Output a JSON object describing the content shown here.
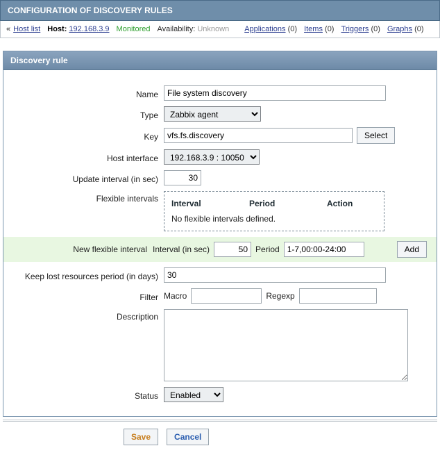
{
  "page_title": "CONFIGURATION OF DISCOVERY RULES",
  "breadcrumb": {
    "back": "Host list",
    "host_label": "Host:",
    "host_ip": "192.168.3.9",
    "status": "Monitored",
    "availability_label": "Availability:",
    "availability_value": "Unknown",
    "links": [
      {
        "label": "Applications",
        "count": "(0)"
      },
      {
        "label": "Items",
        "count": "(0)"
      },
      {
        "label": "Triggers",
        "count": "(0)"
      },
      {
        "label": "Graphs",
        "count": "(0)"
      }
    ]
  },
  "panel_title": "Discovery rule",
  "labels": {
    "name": "Name",
    "type": "Type",
    "key": "Key",
    "host_interface": "Host interface",
    "update_interval": "Update interval (in sec)",
    "flex_intervals": "Flexible intervals",
    "flex_head_interval": "Interval",
    "flex_head_period": "Period",
    "flex_head_action": "Action",
    "flex_empty": "No flexible intervals defined.",
    "new_flex": "New flexible interval",
    "new_flex_interval": "Interval (in sec)",
    "new_flex_period": "Period",
    "keep_lost": "Keep lost resources period (in days)",
    "filter": "Filter",
    "filter_macro": "Macro",
    "filter_regexp": "Regexp",
    "description": "Description",
    "status": "Status"
  },
  "values": {
    "name": "File system discovery",
    "type": "Zabbix agent",
    "key": "vfs.fs.discovery",
    "host_interface": "192.168.3.9 : 10050",
    "update_interval": "30",
    "new_flex_interval": "50",
    "new_flex_period": "1-7,00:00-24:00",
    "keep_lost": "30",
    "filter_macro": "",
    "filter_regexp": "",
    "description": "",
    "status": "Enabled"
  },
  "buttons": {
    "select": "Select",
    "add": "Add",
    "save": "Save",
    "cancel": "Cancel"
  }
}
